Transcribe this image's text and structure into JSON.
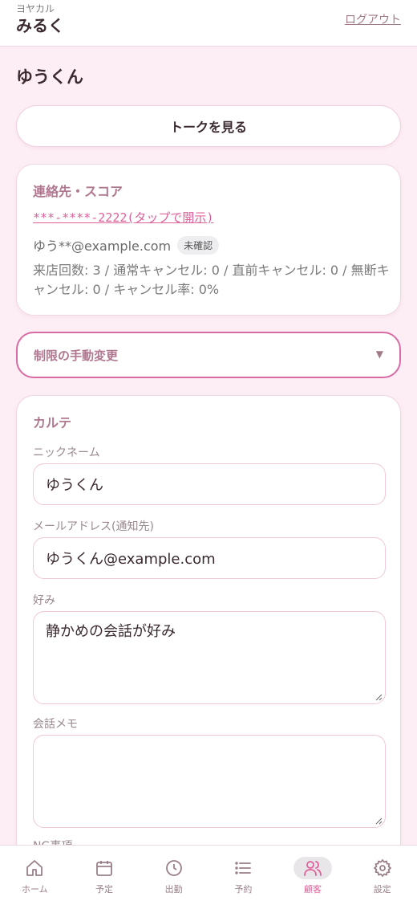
{
  "header": {
    "shop_kana": "ヨヤカル",
    "shop_name": "みるく",
    "logout_label": "ログアウト"
  },
  "customer": {
    "name": "ゆうくん"
  },
  "talk_button_label": "トークを見る",
  "contact": {
    "title": "連絡先・スコア",
    "phone_masked": "***-****-2222(タップで開示)",
    "email_masked": "ゆう**@example.com",
    "email_badge": "未確認",
    "stats_line": "来店回数: 3 / 通常キャンセル: 0 / 直前キャンセル: 0 / 無断キャンセル: 0 / キャンセル率: 0%"
  },
  "restriction": {
    "label": "制限の手動変更"
  },
  "karte": {
    "title": "カルテ",
    "nickname_label": "ニックネーム",
    "nickname_value": "ゆうくん",
    "email_label": "メールアドレス(通知先)",
    "email_value": "ゆうくん@example.com",
    "preference_label": "好み",
    "preference_value": "静かめの会話が好み",
    "memo_label": "会話メモ",
    "memo_value": "",
    "ng_label": "NG事項"
  },
  "nav": {
    "items": [
      {
        "label": "ホーム",
        "icon": "home-icon"
      },
      {
        "label": "予定",
        "icon": "calendar-icon"
      },
      {
        "label": "出勤",
        "icon": "clock-icon"
      },
      {
        "label": "予約",
        "icon": "list-icon"
      },
      {
        "label": "顧客",
        "icon": "users-icon",
        "active": true
      },
      {
        "label": "設定",
        "icon": "gear-icon"
      }
    ]
  },
  "colors": {
    "accent": "#e0609a",
    "background": "#fdeef5",
    "nav_inactive": "#9a7f8a"
  }
}
